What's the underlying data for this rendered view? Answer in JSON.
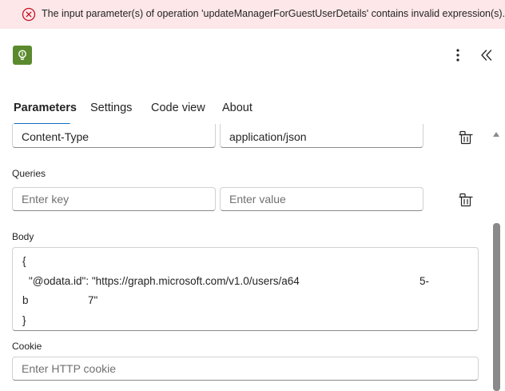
{
  "error_banner": {
    "message": "The input parameter(s) of operation 'updateManagerForGuestUserDetails' contains invalid expression(s). Fix invalid expression(s) for the input parameter(s) of operation"
  },
  "header": {
    "app_icon": "lightbulb-icon",
    "more_icon": "more-vertical-icon",
    "collapse_icon": "double-chevron-left-icon"
  },
  "tabs": [
    {
      "label": "Parameters",
      "active": true
    },
    {
      "label": "Settings",
      "active": false
    },
    {
      "label": "Code view",
      "active": false
    },
    {
      "label": "About",
      "active": false
    }
  ],
  "headers_row": {
    "key": "Content-Type",
    "value": "application/json"
  },
  "queries": {
    "label": "Queries",
    "key_placeholder": "Enter key",
    "value_placeholder": "Enter value"
  },
  "body": {
    "label": "Body",
    "lines": [
      "{",
      "\"@odata.id\": \"https://graph.microsoft.com/v1.0/users/a64",
      "5-",
      "b",
      "7\"",
      "}"
    ]
  },
  "cookie": {
    "label": "Cookie",
    "placeholder": "Enter HTTP cookie"
  },
  "colors": {
    "error_background": "#fde7e9",
    "error_icon": "#c50f1f",
    "accent": "#0f6cbd",
    "app_icon_background": "#5b8a2e"
  }
}
